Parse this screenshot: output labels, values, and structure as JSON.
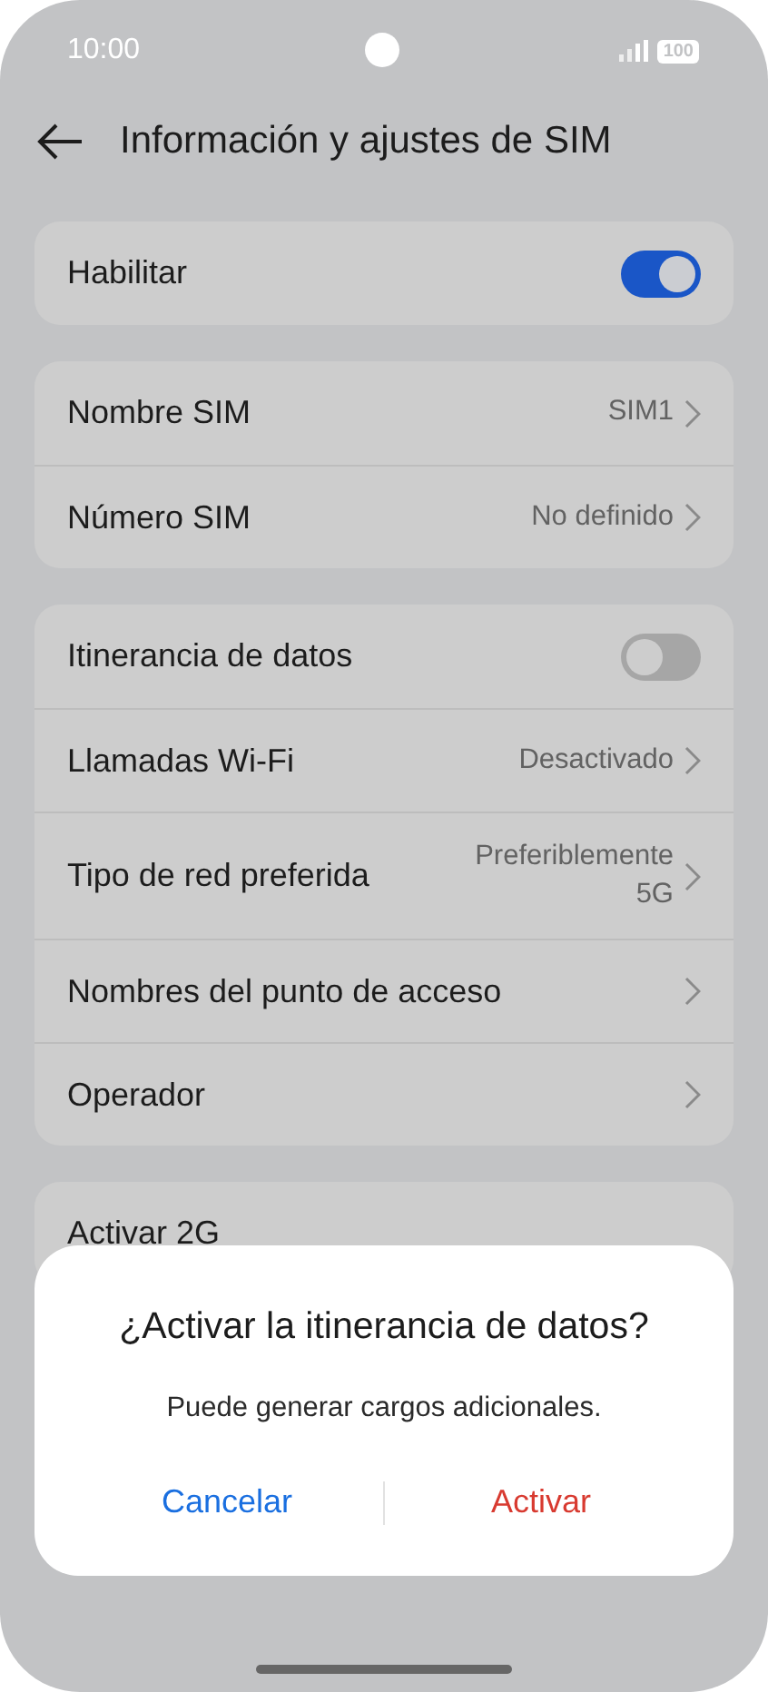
{
  "status_bar": {
    "time": "10:00",
    "battery": "100"
  },
  "header": {
    "title": "Información y ajustes de SIM"
  },
  "groups": [
    {
      "rows": [
        {
          "kind": "toggle",
          "label": "Habilitar",
          "on": true
        }
      ]
    },
    {
      "rows": [
        {
          "kind": "link",
          "label": "Nombre SIM",
          "value": "SIM1"
        },
        {
          "kind": "link",
          "label": "Número SIM",
          "value": "No definido"
        }
      ]
    },
    {
      "rows": [
        {
          "kind": "toggle",
          "label": "Itinerancia de datos",
          "on": false
        },
        {
          "kind": "link",
          "label": "Llamadas Wi-Fi",
          "value": "Desactivado"
        },
        {
          "kind": "link",
          "label": "Tipo de red preferida",
          "value": "Preferiblemente 5G"
        },
        {
          "kind": "link",
          "label": "Nombres del punto de acceso"
        },
        {
          "kind": "link",
          "label": "Operador"
        }
      ]
    },
    {
      "rows": [
        {
          "kind": "plain",
          "label": "Activar 2G"
        }
      ]
    }
  ],
  "dialog": {
    "title": "¿Activar la itinerancia de datos?",
    "message": "Puede generar cargos adicionales.",
    "buttons": [
      {
        "label": "Cancelar",
        "kind": "cancel"
      },
      {
        "label": "Activar",
        "kind": "confirm"
      }
    ]
  }
}
